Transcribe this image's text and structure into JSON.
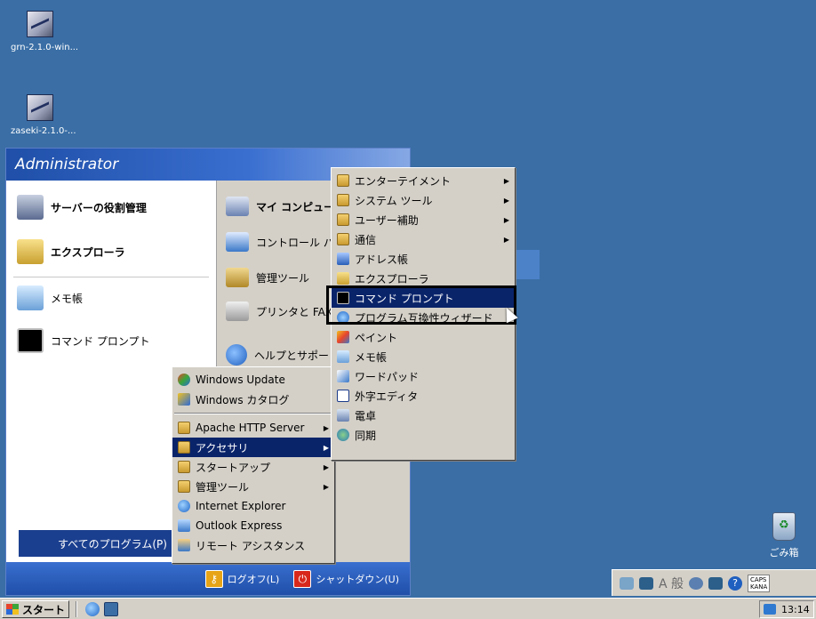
{
  "desktop": {
    "icons": [
      {
        "label": "grn-2.1.0-win..."
      },
      {
        "label": "zaseki-2.1.0-..."
      }
    ],
    "recycle_bin": {
      "label": "ごみ箱"
    }
  },
  "start_menu": {
    "user": "Administrator",
    "left_items": [
      {
        "label": "サーバーの役割管理",
        "icon": "server-icon"
      },
      {
        "label": "エクスプローラ",
        "icon": "explorer-icon"
      },
      {
        "label": "メモ帳",
        "icon": "notepad-icon"
      },
      {
        "label": "コマンド プロンプト",
        "icon": "cmd-icon"
      }
    ],
    "right_items": [
      {
        "label": "マイ コンピュータ",
        "icon": "computer-icon"
      },
      {
        "label": "コントロール パネル",
        "icon": "control-panel-icon"
      },
      {
        "label": "管理ツール",
        "icon": "admin-tools-icon"
      },
      {
        "label": "プリンタと FAX",
        "icon": "printer-icon"
      },
      {
        "label": "ヘルプとサポート",
        "icon": "help-icon"
      }
    ],
    "all_programs": "すべてのプログラム(P)",
    "logoff": "ログオフ(L)",
    "shutdown": "シャットダウン(U)"
  },
  "programs_menu": {
    "items": [
      {
        "label": "Windows Update",
        "icon": "windows-update-icon"
      },
      {
        "label": "Windows カタログ",
        "icon": "windows-catalog-icon"
      },
      {
        "label": "Apache HTTP Server",
        "icon": "folder-icon",
        "submenu": true
      },
      {
        "label": "アクセサリ",
        "icon": "folder-icon",
        "submenu": true,
        "selected": true
      },
      {
        "label": "スタートアップ",
        "icon": "folder-icon",
        "submenu": true
      },
      {
        "label": "管理ツール",
        "icon": "folder-icon",
        "submenu": true
      },
      {
        "label": "Internet Explorer",
        "icon": "ie-icon"
      },
      {
        "label": "Outlook Express",
        "icon": "outlook-icon"
      },
      {
        "label": "リモート アシスタンス",
        "icon": "remote-assistance-icon"
      }
    ]
  },
  "accessories_menu": {
    "items": [
      {
        "label": "エンターテイメント",
        "icon": "folder-icon",
        "submenu": true
      },
      {
        "label": "システム ツール",
        "icon": "folder-icon",
        "submenu": true
      },
      {
        "label": "ユーザー補助",
        "icon": "folder-icon",
        "submenu": true
      },
      {
        "label": "通信",
        "icon": "folder-icon",
        "submenu": true
      },
      {
        "label": "アドレス帳",
        "icon": "address-book-icon"
      },
      {
        "label": "エクスプローラ",
        "icon": "explorer-icon"
      },
      {
        "label": "コマンド プロンプト",
        "icon": "cmd-icon",
        "selected": true
      },
      {
        "label": "プログラム互換性ウィザード",
        "icon": "compat-wizard-icon"
      },
      {
        "label": "ペイント",
        "icon": "paint-icon"
      },
      {
        "label": "メモ帳",
        "icon": "notepad-icon"
      },
      {
        "label": "ワードパッド",
        "icon": "wordpad-icon"
      },
      {
        "label": "外字エディタ",
        "icon": "eudc-icon"
      },
      {
        "label": "電卓",
        "icon": "calculator-icon"
      },
      {
        "label": "同期",
        "icon": "sync-icon"
      }
    ]
  },
  "language_bar": {
    "ime_text": "A 般",
    "caps": "CAPS",
    "kana": "KANA"
  },
  "taskbar": {
    "start_label": "スタート",
    "clock": "13:14"
  },
  "colors": {
    "desktop": "#3a6ea5",
    "selection": "#0a246a",
    "menu_bg": "#d4d0c8"
  }
}
